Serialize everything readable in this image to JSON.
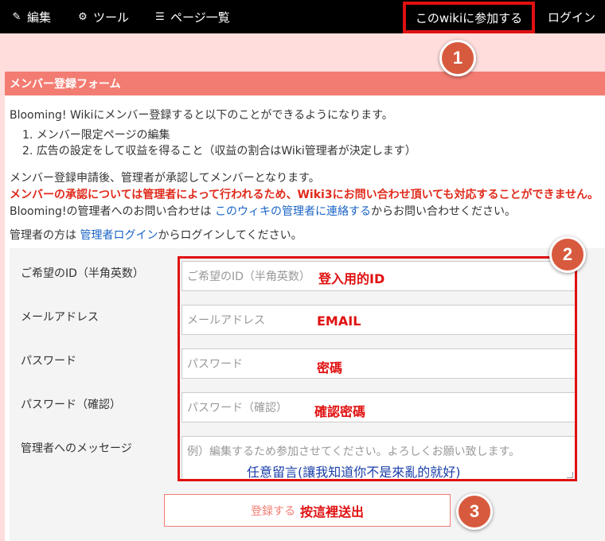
{
  "nav": {
    "edit": "編集",
    "tools": "ツール",
    "pages": "ページ一覧",
    "join": "このwikiに参加する",
    "login": "ログイン"
  },
  "icons": {
    "edit": "pencil-square-icon",
    "tools": "gear-icon",
    "pages": "list-icon"
  },
  "badges": {
    "one": "1",
    "two": "2",
    "three": "3"
  },
  "card": {
    "title": "メンバー登録フォーム",
    "intro": "Blooming! Wikiにメンバー登録すると以下のことができるようになります。",
    "list": [
      "1. メンバー限定ページの編集",
      "2. 広告の設定をして収益を得ること（収益の割合はWiki管理者が決定します）"
    ],
    "note1": "メンバー登録申請後、管理者が承認してメンバーとなります。",
    "note_red": "メンバーの承認については管理者によって行われるため、Wiki3にお問い合わせ頂いても対応することができません。",
    "note3_prefix": "Blooming!の管理者へのお問い合わせは ",
    "note3_link": "このウィキの管理者に連絡する",
    "note3_suffix": "からお問い合わせください。",
    "admin_prefix": "管理者の方は ",
    "admin_link": "管理者ログイン",
    "admin_suffix": "からログインしてください。"
  },
  "form": {
    "fields": [
      {
        "label": "ご希望のID（半角英数）",
        "placeholder": "ご希望のID（半角英数）",
        "annotation": "登入用的ID"
      },
      {
        "label": "メールアドレス",
        "placeholder": "メールアドレス",
        "annotation": "EMAIL"
      },
      {
        "label": "パスワード",
        "placeholder": "パスワード",
        "annotation": "密碼"
      },
      {
        "label": "パスワード（確認）",
        "placeholder": "パスワード（確認）",
        "annotation": "確認密碼"
      }
    ],
    "message": {
      "label": "管理者へのメッセージ",
      "placeholder": "例）編集するため参加させてください。よろしくお願い致します。",
      "annotation": "任意留言(讓我知道你不是來亂的就好)"
    },
    "submit_label": "登録する",
    "submit_annotation": "按這裡送出"
  },
  "colors": {
    "page_bg": "#ffdddd",
    "topbar": "#000000",
    "header": "#f37c72",
    "highlight": "#e01010",
    "badge": "#d85a3e",
    "link": "#1a63c5"
  }
}
